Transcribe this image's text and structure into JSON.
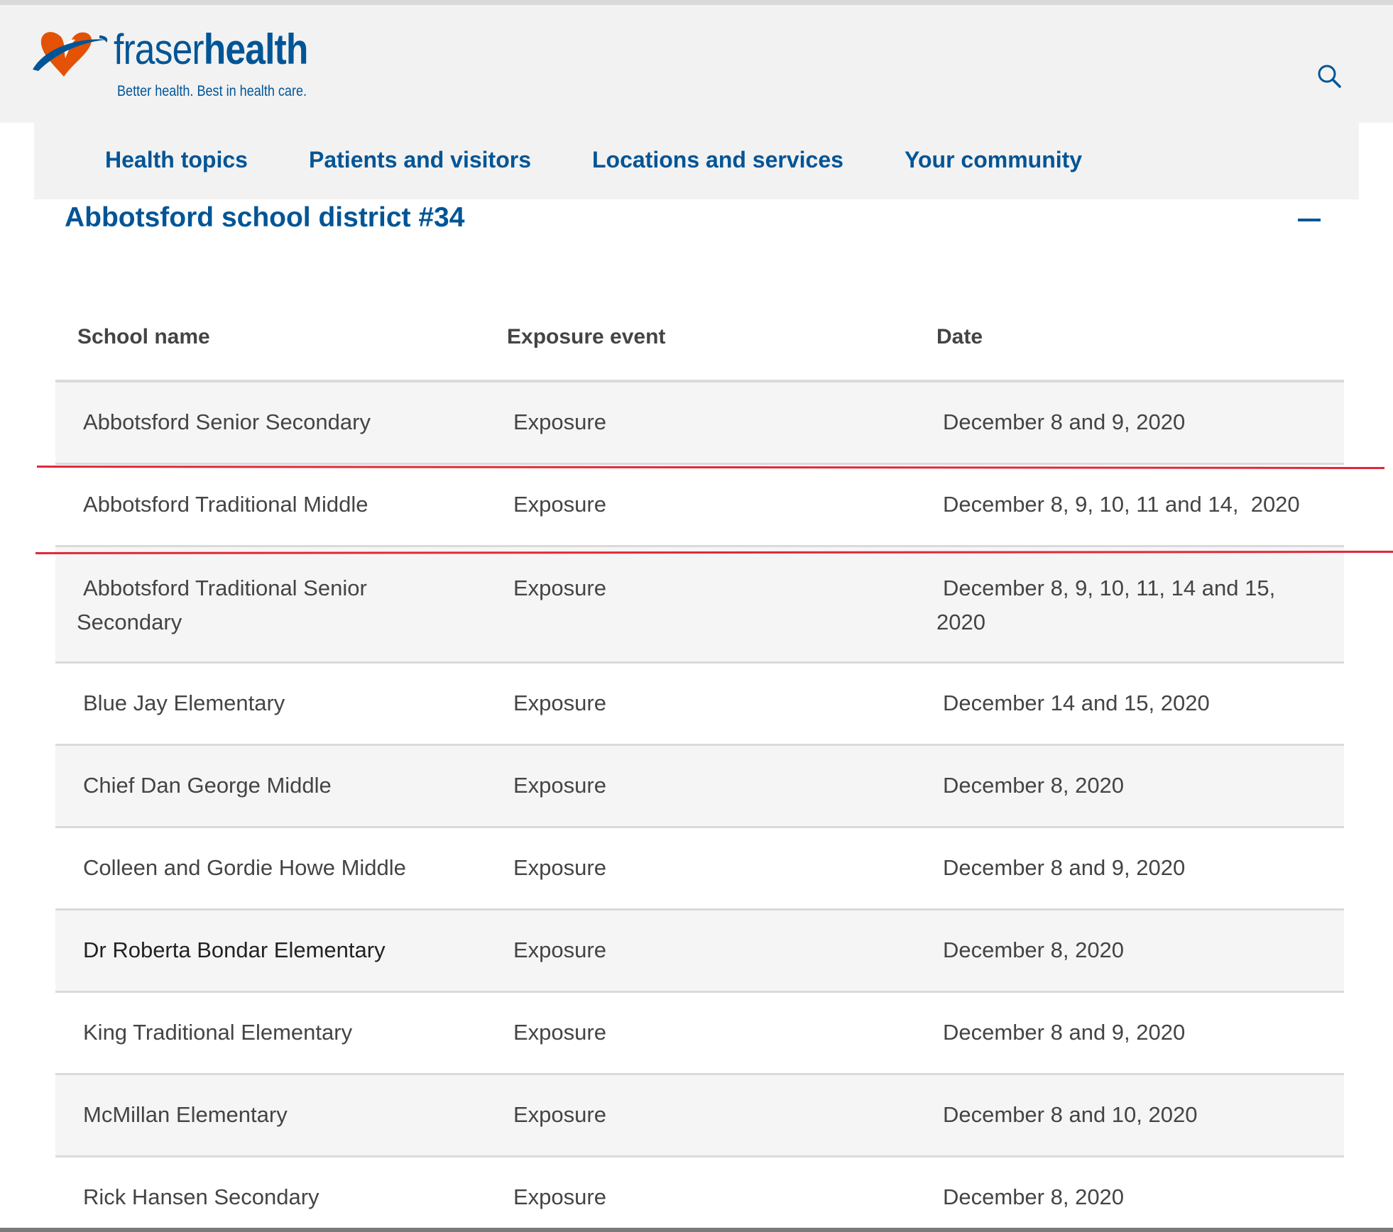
{
  "brand": {
    "name_thin": "fraser",
    "name_bold": "health",
    "tagline": "Better health. Best in health care.",
    "color": "#005596",
    "accent": "#e35205"
  },
  "nav": {
    "items": [
      {
        "label": "Health topics"
      },
      {
        "label": "Patients and visitors"
      },
      {
        "label": "Locations and services"
      },
      {
        "label": "Your community"
      }
    ]
  },
  "section": {
    "title": "Abbotsford school district #34"
  },
  "table": {
    "headers": [
      "School name",
      "Exposure event",
      "Date"
    ],
    "rows": [
      {
        "school": "Abbotsford Senior Secondary",
        "event": "Exposure",
        "date": "December 8 and 9, 2020"
      },
      {
        "school": "Abbotsford Traditional Middle",
        "event": "Exposure",
        "date": "December 8, 9, 10, 11 and 14,  2020"
      },
      {
        "school": "Abbotsford Traditional Senior Secondary",
        "event": "Exposure",
        "date": "December 8, 9, 10, 11, 14 and 15, 2020"
      },
      {
        "school": "Blue Jay Elementary",
        "event": "Exposure",
        "date": "December 14 and 15, 2020"
      },
      {
        "school": "Chief Dan George Middle",
        "event": "Exposure",
        "date": "December 8, 2020"
      },
      {
        "school": "Colleen and Gordie Howe Middle",
        "event": "Exposure",
        "date": "December 8 and 9, 2020"
      },
      {
        "school": "Dr Roberta Bondar Elementary",
        "event": "Exposure",
        "date": "December 8, 2020"
      },
      {
        "school": "King Traditional Elementary",
        "event": "Exposure",
        "date": "December 8 and 9, 2020"
      },
      {
        "school": "McMillan Elementary",
        "event": "Exposure",
        "date": "December 8 and 10, 2020"
      },
      {
        "school": "Rick Hansen Secondary",
        "event": "Exposure",
        "date": "December 8, 2020"
      }
    ]
  },
  "annotation": {
    "highlight_color": "#e0283a"
  }
}
